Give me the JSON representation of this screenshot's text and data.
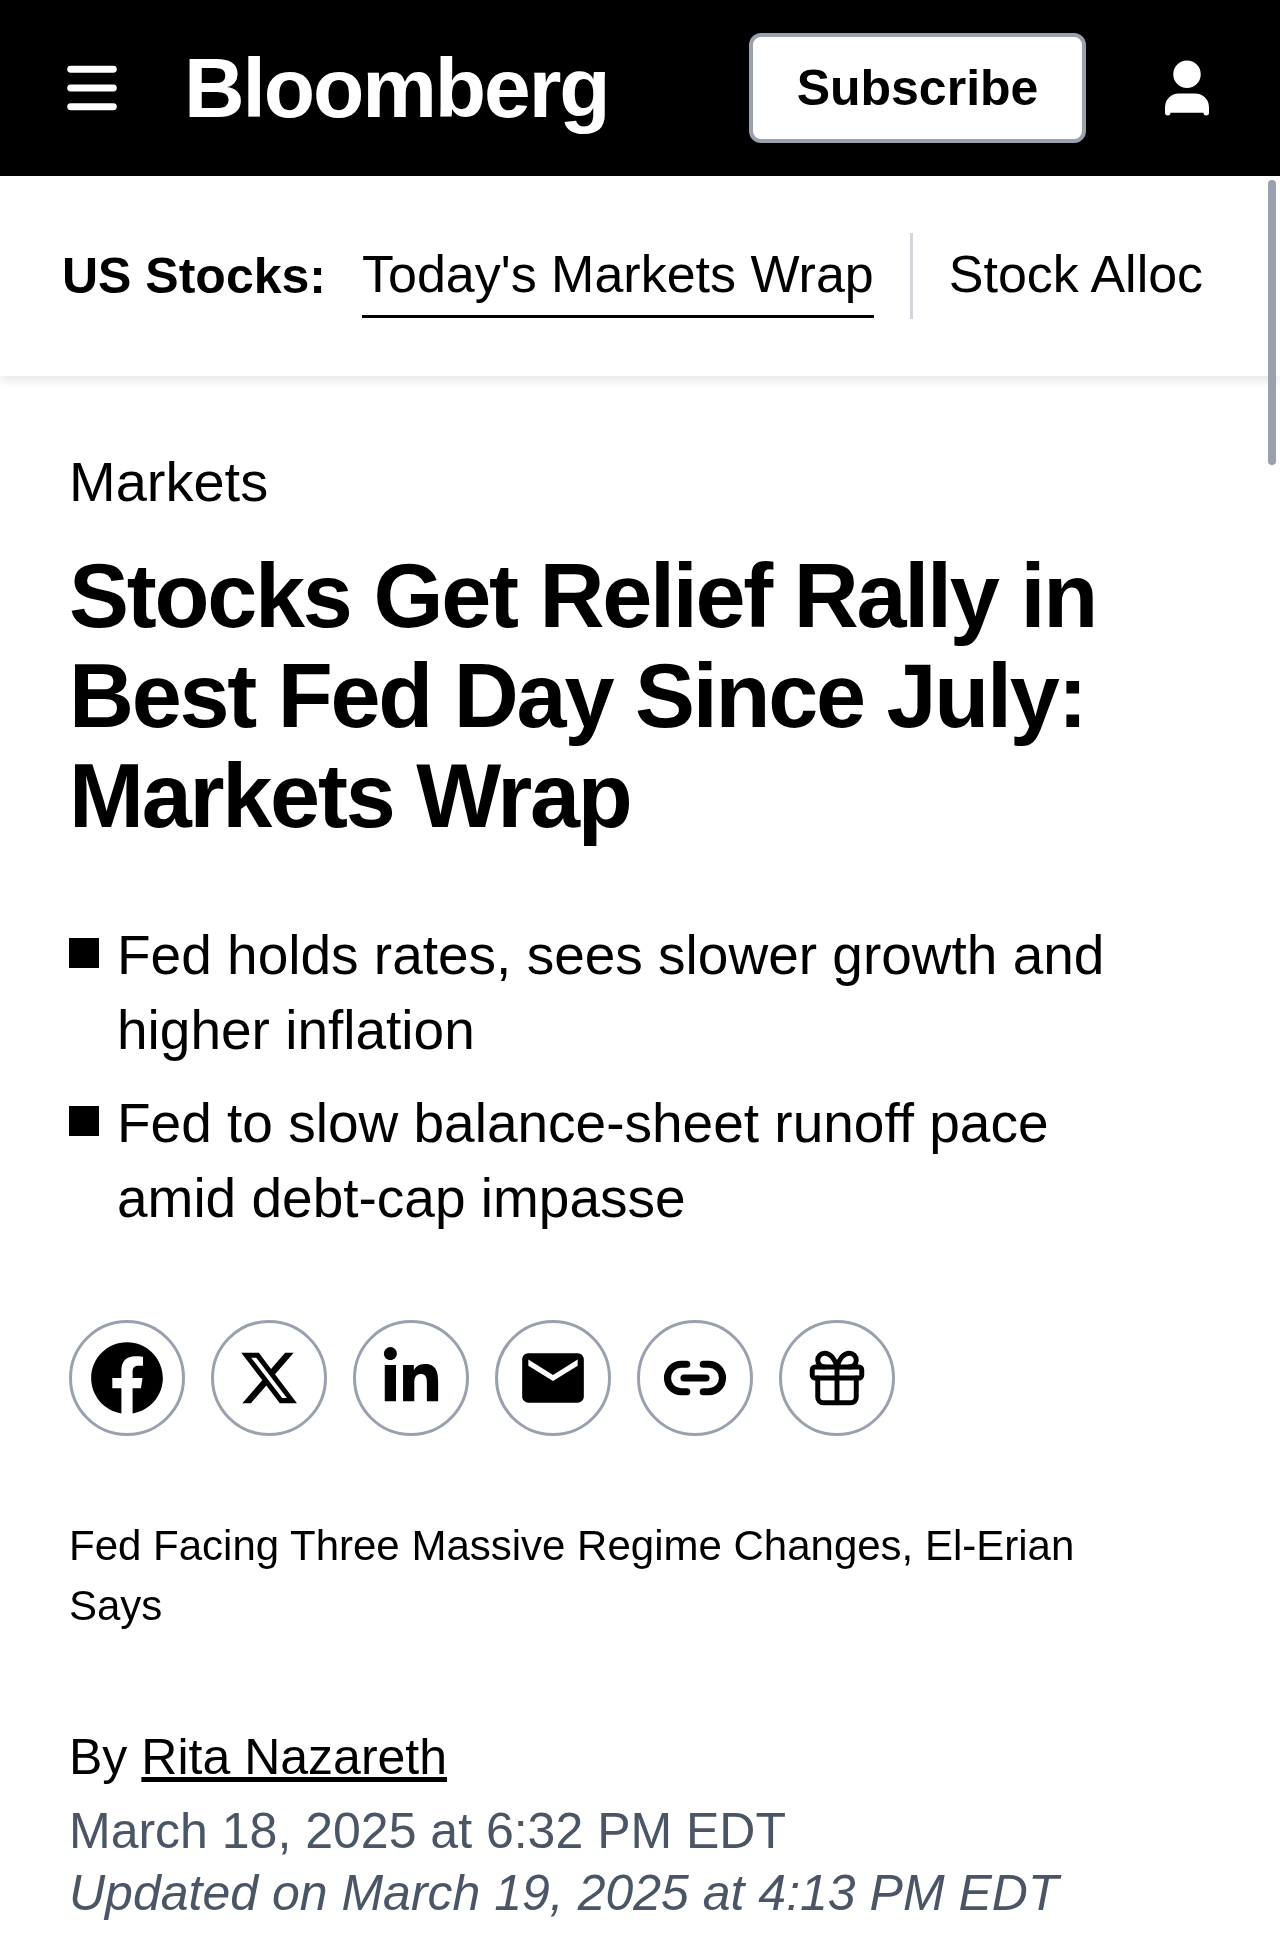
{
  "header": {
    "logo": "Bloomberg",
    "subscribe": "Subscribe"
  },
  "nav": {
    "label": "US Stocks:",
    "links": [
      {
        "label": "Today's Markets Wrap",
        "selected": true
      },
      {
        "label": "Stock Alloc",
        "selected": false
      }
    ]
  },
  "article": {
    "section": "Markets",
    "headline": "Stocks Get Relief Rally in Best Fed Day Since July: Markets Wrap",
    "bullets": [
      "Fed holds rates, sees slower growth and higher inflation",
      "Fed to slow balance-sheet runoff pace amid debt-cap impasse"
    ],
    "video_caption": "Fed Facing Three Massive Regime Changes, El-Erian Says",
    "byline_prefix": "By",
    "author": "Rita Nazareth",
    "published": "March 18, 2025 at 6:32 PM EDT",
    "updated": "Updated on March 19, 2025 at 4:13 PM EDT"
  }
}
